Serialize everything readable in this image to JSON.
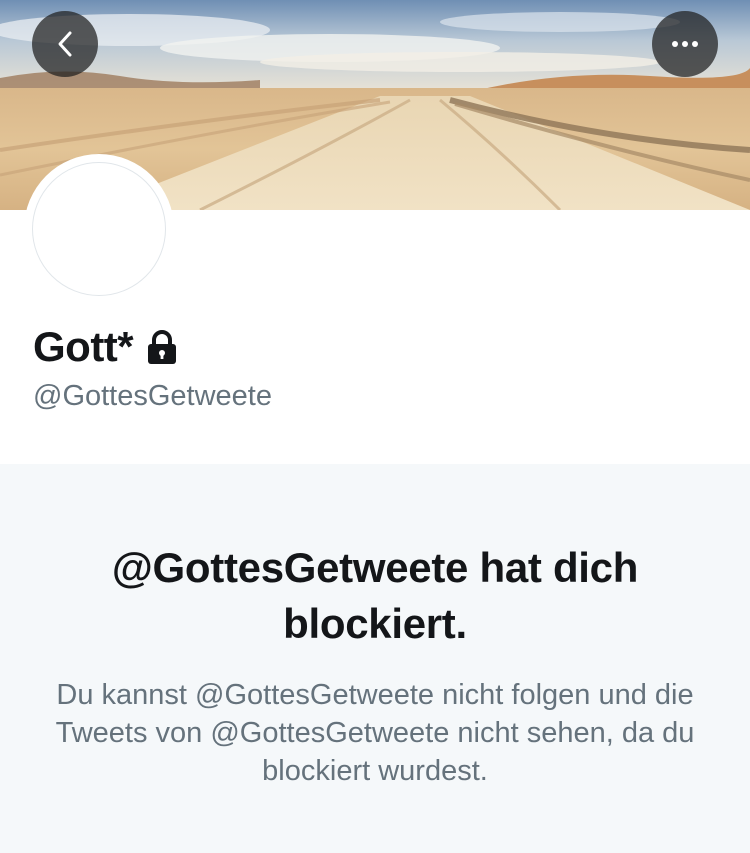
{
  "profile": {
    "display_name": "Gott*",
    "handle": "@GottesGetweete",
    "protected_icon": "lock-icon"
  },
  "header": {
    "back_icon": "chevron-left-icon",
    "more_icon": "more-horizontal-icon"
  },
  "blocked": {
    "title": "@GottesGetweete hat dich blockiert.",
    "description": "Du kannst @GottesGetweete nicht folgen und die Tweets von @GottesGetweete nicht sehen, da du blockiert wurdest."
  },
  "colors": {
    "text_primary": "#141619",
    "text_secondary": "#65727c",
    "panel_background": "#f5f8fa",
    "button_overlay": "#1e1e1e"
  }
}
